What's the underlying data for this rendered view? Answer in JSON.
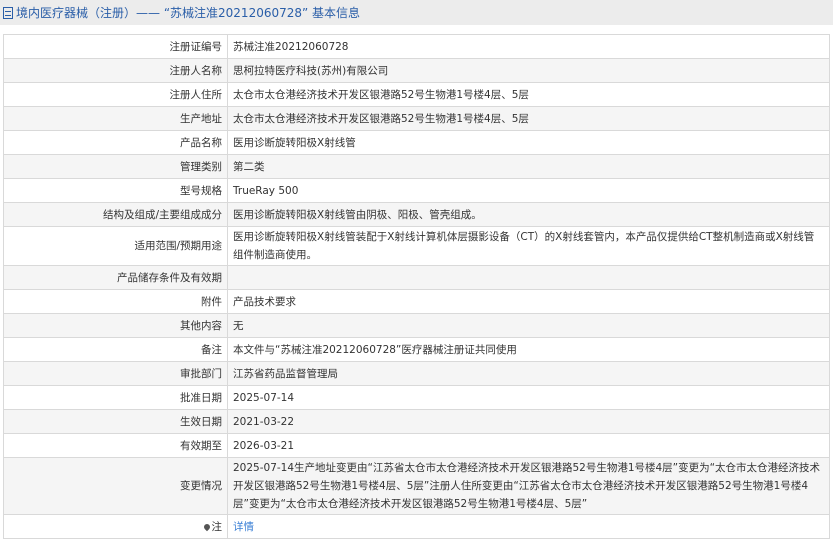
{
  "header": {
    "title": "境内医疗器械（注册）—— “苏械注准20212060728” 基本信息"
  },
  "rows": [
    {
      "label": "注册证编号",
      "value": "苏械注准20212060728"
    },
    {
      "label": "注册人名称",
      "value": "思柯拉特医疗科技(苏州)有限公司"
    },
    {
      "label": "注册人住所",
      "value": "太仓市太仓港经济技术开发区银港路52号生物港1号楼4层、5层"
    },
    {
      "label": "生产地址",
      "value": "太仓市太仓港经济技术开发区银港路52号生物港1号楼4层、5层"
    },
    {
      "label": "产品名称",
      "value": "医用诊断旋转阳极X射线管"
    },
    {
      "label": "管理类别",
      "value": "第二类"
    },
    {
      "label": "型号规格",
      "value": "TrueRay 500"
    },
    {
      "label": "结构及组成/主要组成成分",
      "value": "医用诊断旋转阳极X射线管由阴极、阳极、管壳组成。"
    },
    {
      "label": "适用范围/预期用途",
      "value": "医用诊断旋转阳极X射线管装配于X射线计算机体层摄影设备（CT）的X射线套管内，本产品仅提供给CT整机制造商或X射线管组件制造商使用。"
    },
    {
      "label": "产品储存条件及有效期",
      "value": ""
    },
    {
      "label": "附件",
      "value": "产品技术要求"
    },
    {
      "label": "其他内容",
      "value": "无"
    },
    {
      "label": "备注",
      "value": "本文件与“苏械注准20212060728”医疗器械注册证共同使用"
    },
    {
      "label": "审批部门",
      "value": "江苏省药品监督管理局"
    },
    {
      "label": "批准日期",
      "value": "2025-07-14"
    },
    {
      "label": "生效日期",
      "value": "2021-03-22"
    },
    {
      "label": "有效期至",
      "value": "2026-03-21"
    },
    {
      "label": "变更情况",
      "value": "2025-07-14生产地址变更由“江苏省太仓市太仓港经济技术开发区银港路52号生物港1号楼4层”变更为“太仓市太仓港经济技术开发区银港路52号生物港1号楼4层、5层”注册人住所变更由“江苏省太仓市太仓港经济技术开发区银港路52号生物港1号楼4层”变更为“太仓市太仓港经济技术开发区银港路52号生物港1号楼4层、5层”"
    }
  ],
  "note": {
    "label": "注",
    "link": "详情"
  }
}
